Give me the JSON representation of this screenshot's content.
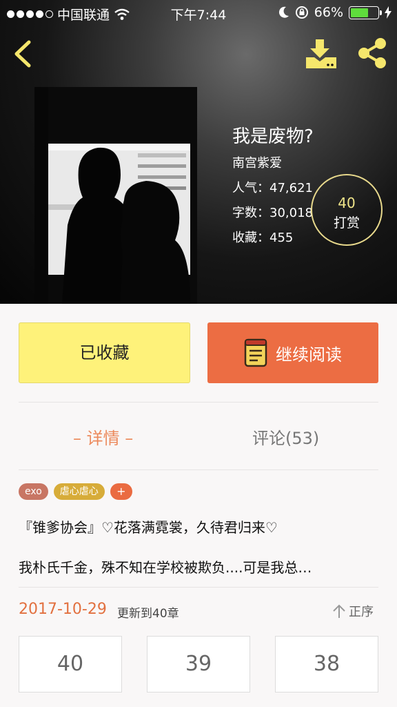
{
  "status_bar": {
    "carrier": "中国联通",
    "time": "下午7:44",
    "battery": "66%",
    "battery_level": 0.66,
    "battery_color": "#5fdc3c"
  },
  "header": {
    "back_icon": "chevron-left-icon",
    "download_icon": "download-icon",
    "share_icon": "share-icon",
    "icon_color": "#f5e66c"
  },
  "book": {
    "title": "我是废物?",
    "author": "南宫紫爱",
    "popularity": "人气：47,621",
    "word_count": "字数：30,018",
    "favorites": "收藏：455"
  },
  "reward": {
    "count": "40",
    "label": "打赏"
  },
  "actions": {
    "collected_label": "已收藏",
    "continue_label": "继续阅读",
    "continue_color": "#ec6d43",
    "collected_color": "#fef27a"
  },
  "tabs": {
    "detail": "– 详情 –",
    "comments": "评论(53)"
  },
  "tags": [
    {
      "label": "exo",
      "color": "#c87664"
    },
    {
      "label": "虐心虐心",
      "color": "#d7ac39"
    },
    {
      "label": "+",
      "color": "#ea6b41"
    }
  ],
  "summary": {
    "line1": "『锥爹协会』♡花落满霓裳，久待君归来♡",
    "line2": "我朴氏千金，殊不知在学校被欺负....可是我总…"
  },
  "update": {
    "date": "2017-10-29",
    "text": "更新到40章",
    "sort_label": "正序"
  },
  "chapters": [
    "40",
    "39",
    "38"
  ]
}
